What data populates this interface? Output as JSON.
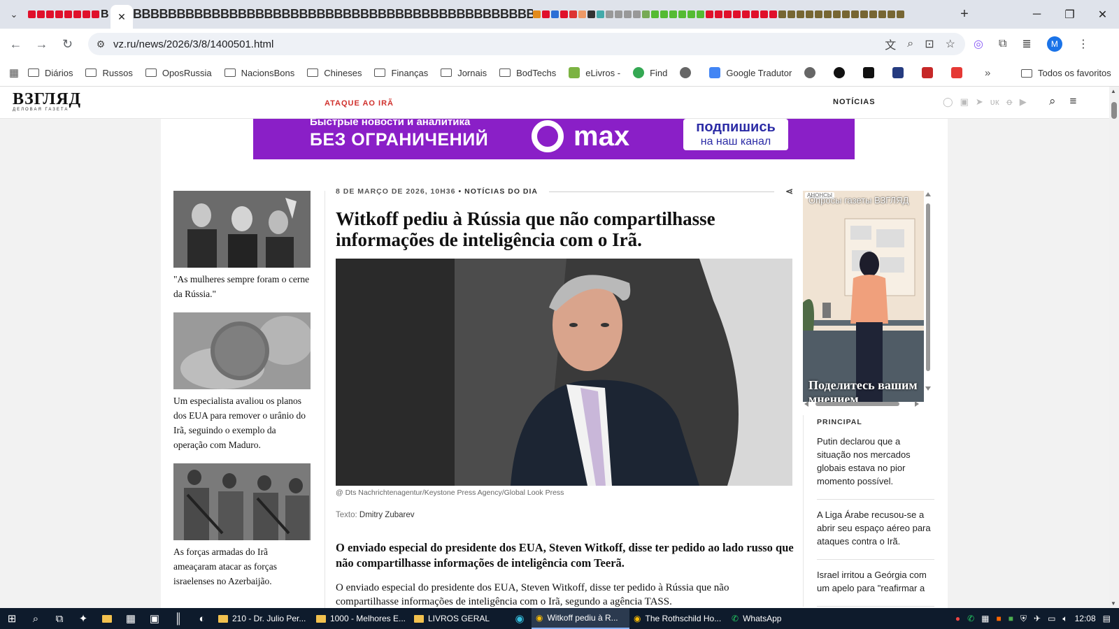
{
  "browser": {
    "tab_strip_b_text": "BBBBBBBBBBBBBBBBBBBBBBBBBBBBBBBBBBBBBBBBBBBBBB",
    "first_tab_b": "B",
    "new_tab_label": "+",
    "url": "vz.ru/news/2026/3/8/1400501.html",
    "profile_initial": "M"
  },
  "bookmarks": {
    "items": [
      {
        "label": "Diários"
      },
      {
        "label": "Russos"
      },
      {
        "label": "OposRussia"
      },
      {
        "label": "NacionsBons"
      },
      {
        "label": "Chineses"
      },
      {
        "label": "Finanças"
      },
      {
        "label": "Jornais"
      },
      {
        "label": "BodTechs"
      },
      {
        "label": "eLivros -"
      },
      {
        "label": "Find"
      },
      {
        "label": "Google Tradutor"
      }
    ],
    "all_label": "Todos os favoritos"
  },
  "site": {
    "logo": "ВЗГЛЯД",
    "logo_sub": "ДЕЛОВАЯ ГАЗЕТА",
    "nav_ataque": "ATAQUE AO IRÃ",
    "nav_noticias": "NOTÍCIAS"
  },
  "banner": {
    "line1": "Быстрые новости и аналитика",
    "line2": "БЕЗ ОГРАНИЧЕНИЙ",
    "brand": "max",
    "cta1": "подпишись",
    "cta2": "на наш канал"
  },
  "sidebar": {
    "items": [
      {
        "caption": "\"As mulheres sempre foram o cerne da Rússia.\""
      },
      {
        "caption": "Um especialista avaliou os planos dos EUA para remover o urânio do Irã, seguindo o exemplo da operação com Maduro."
      },
      {
        "caption": "As forças armadas do Irã ameaçaram atacar as forças israelenses no Azerbaijão."
      }
    ]
  },
  "article": {
    "date": "8 DE MARÇO DE 2026, 10H36",
    "sep": "•",
    "section": "NOTÍCIAS DO DIA",
    "headline": "Witkoff pediu à Rússia que não compartilhasse informações de inteligência com o Irã.",
    "photo_credit": "@ Dts Nachrichtenagentur/Keystone Press Agency/Global Look Press",
    "author_label": "Texto:",
    "author": "Dmitry Zubarev",
    "lead": "O enviado especial do presidente dos EUA, Steven Witkoff, disse ter pedido ao lado russo que não compartilhasse informações de inteligência com Teerã.",
    "body": "O enviado especial do presidente dos EUA, Steven Witkoff, disse ter pedido à Rússia que não compartilhasse informações de inteligência com o Irã, segundo a agência TASS."
  },
  "ad": {
    "label": "АНОНСЫ",
    "top_text": "Опросы газеты ВЗГЛЯД",
    "bottom_text": "Поделитесь вашим мнением"
  },
  "principal": {
    "heading": "PRINCIPAL",
    "items": [
      {
        "text": "Putin declarou que a situação nos mercados globais estava no pior momento possível."
      },
      {
        "text": "A Liga Árabe recusou-se a abrir seu espaço aéreo para ataques contra o Irã."
      },
      {
        "text": "Israel irritou a Geórgia com um apelo para \"reafirmar a"
      }
    ]
  },
  "taskbar": {
    "apps": [
      {
        "label": "210 - Dr. Julio Per..."
      },
      {
        "label": "1000 - Melhores E..."
      },
      {
        "label": "LIVROS GERAL"
      },
      {
        "label": "Witkoff pediu à R..."
      },
      {
        "label": "The Rothschild Ho..."
      },
      {
        "label": "WhatsApp"
      }
    ],
    "time": "12:08"
  }
}
